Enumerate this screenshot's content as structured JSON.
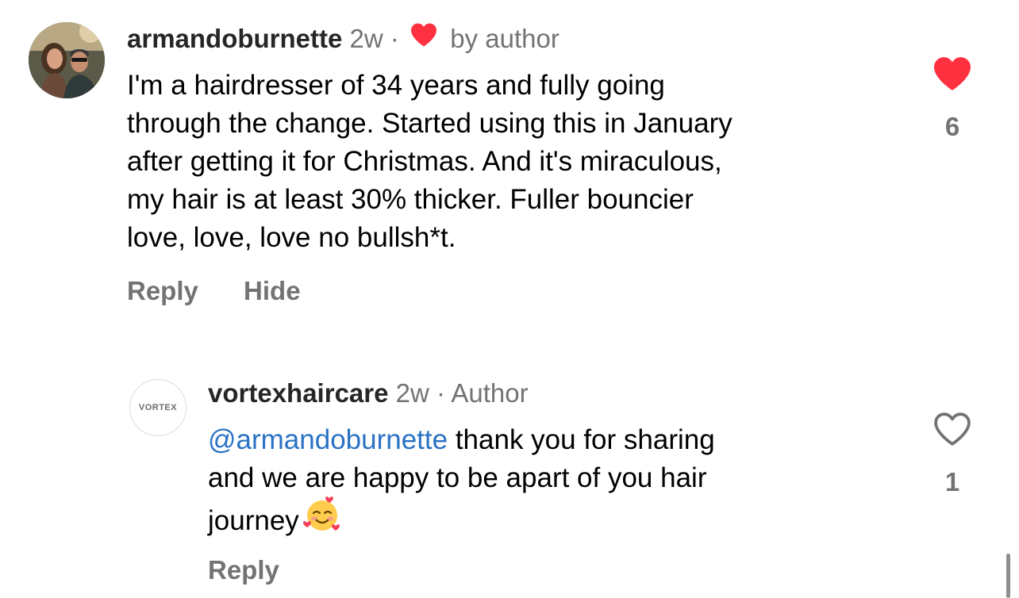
{
  "comments": [
    {
      "username": "armandoburnette",
      "time": "2w",
      "separator": "·",
      "liked_by_author": "by author",
      "text": "I'm a hairdresser of 34 years and fully going\nthrough the change. Started using this in January\nafter getting it for Christmas. And it's miraculous,\nmy hair is at least 30% thicker. Fuller bouncier\nlove, love, love no bullsh*t.",
      "actions": {
        "reply": "Reply",
        "hide": "Hide"
      },
      "likes": "6",
      "liked": true,
      "heart_icon": "heart-filled-icon",
      "heart_color": "#ff3040"
    },
    {
      "username": "vortexhaircare",
      "time": "2w",
      "separator": "·",
      "author_label": "Author",
      "avatar_text": "VORTEX",
      "mention": "@armandoburnette",
      "text": " thank you for sharing\nand we are happy to be apart of you hair\njourney",
      "emoji": "smiling-face-with-hearts-emoji",
      "actions": {
        "reply": "Reply"
      },
      "likes": "1",
      "liked": false,
      "heart_icon": "heart-outline-icon"
    }
  ],
  "colors": {
    "mention": "#2a72c4",
    "meta": "#737373",
    "like_red": "#ff3040"
  }
}
